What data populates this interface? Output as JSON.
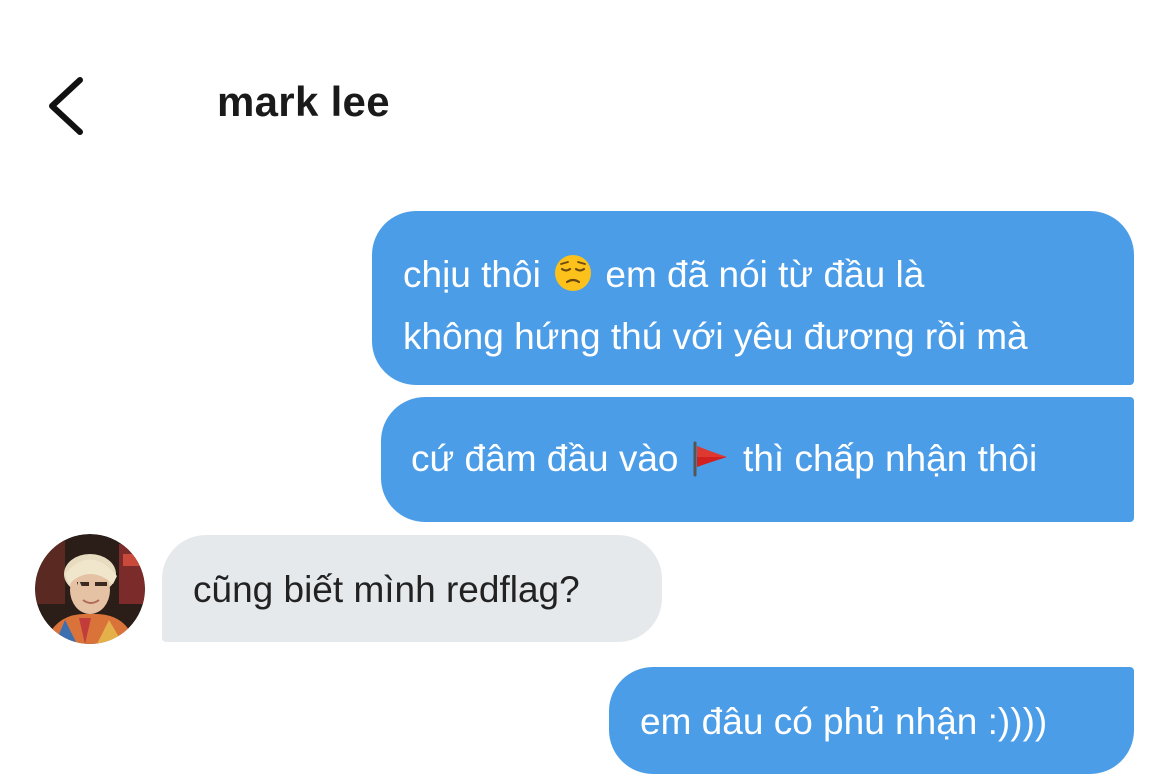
{
  "header": {
    "back_icon": "chevron-left-icon",
    "title": "mark lee"
  },
  "messages": [
    {
      "direction": "outgoing",
      "lines": [
        {
          "before": "chịu thôi",
          "emoji": "pensive-face-emoji",
          "after": "em đã nói từ đầu là"
        },
        {
          "text": "không hứng thú với yêu đương rồi mà"
        }
      ]
    },
    {
      "direction": "outgoing",
      "before": "cứ đâm đầu vào",
      "emoji": "red-flag-emoji",
      "after": "thì chấp nhận thôi"
    },
    {
      "direction": "incoming",
      "avatar": "contact-avatar",
      "text": "cũng biết mình redflag?"
    },
    {
      "direction": "outgoing",
      "text": "em đâu có phủ nhận :))))"
    }
  ],
  "colors": {
    "outgoing_bubble": "#4c9de8",
    "incoming_bubble": "#e6e9ec",
    "outgoing_text": "#ffffff",
    "incoming_text": "#222222"
  }
}
